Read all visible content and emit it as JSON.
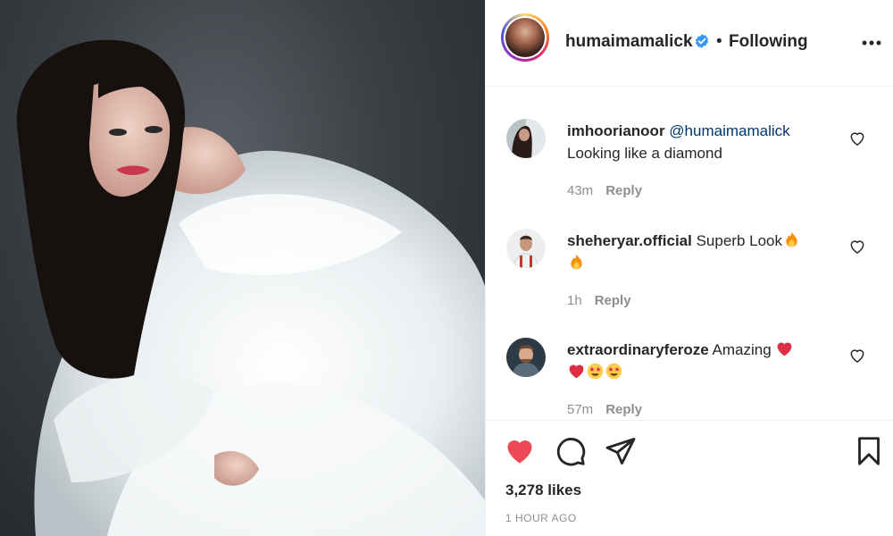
{
  "post": {
    "author": "humaimamalick",
    "follow_status": "Following",
    "separator": "•",
    "likes": "3,278 likes",
    "time_ago": "1 HOUR AGO",
    "liked": true
  },
  "comments": [
    {
      "username": "imhoorianoor",
      "mention": "@humaimamalick",
      "text": "Looking like a diamond",
      "time": "43m",
      "reply": "Reply"
    },
    {
      "username": "sheheryar.official",
      "text": "Superb Look",
      "emojis": [
        "fire",
        "fire"
      ],
      "time": "1h",
      "reply": "Reply"
    },
    {
      "username": "extraordinaryferoze",
      "text": "Amazing",
      "emojis": [
        "red-heart",
        "red-heart",
        "star-struck",
        "star-struck"
      ],
      "time": "57m",
      "reply": "Reply"
    }
  ],
  "icons": {
    "verified": "verified-badge-icon",
    "more": "more-options-icon",
    "like": "heart-filled-icon",
    "comment": "comment-bubble-icon",
    "share": "paper-plane-icon",
    "save": "bookmark-icon",
    "comment_like": "heart-outline-icon"
  },
  "colors": {
    "like_red": "#ed4956",
    "verified_blue": "#3897f0",
    "mention_blue": "#00376b",
    "muted_gray": "#8e8e8e"
  }
}
